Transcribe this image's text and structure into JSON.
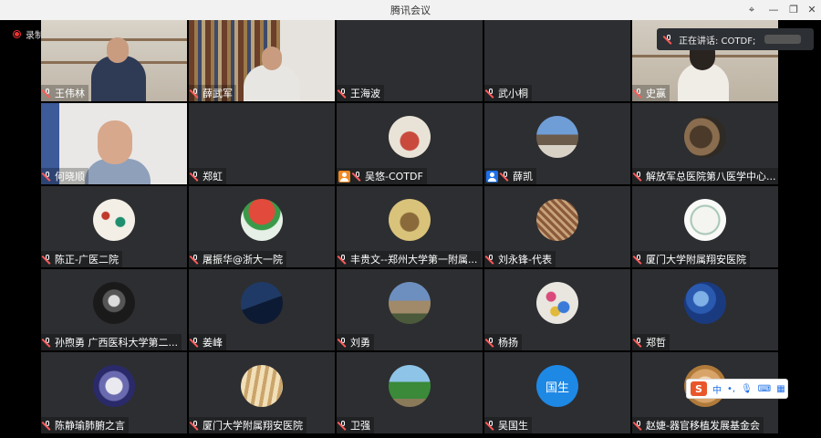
{
  "window": {
    "title": "腾讯会议"
  },
  "recording": {
    "label": "录制中"
  },
  "speaking": {
    "label": "正在讲话: COTDF;"
  },
  "ime": {
    "mode": "中"
  },
  "participants": [
    [
      "王伟林",
      "薛武军",
      "王海波",
      "武小桐",
      "史赢"
    ],
    [
      "何晓顺",
      "郑虹",
      "吴悠-COTDF",
      "薛凯",
      "解放军总医院第八医学中心..."
    ],
    [
      "陈正-广医二院",
      "屠振华@浙大一院",
      "丰贵文--郑州大学第一附属...",
      "刘永锋-代表",
      "厦门大学附属翔安医院"
    ],
    [
      "孙煦勇 广西医科大学第二...",
      "姜峰",
      "刘勇",
      "杨扬",
      "郑哲"
    ],
    [
      "陈静瑜肺腑之言",
      "厦门大学附属翔安医院",
      "卫强",
      "吴国生",
      "赵婕-器官移植发展基金会"
    ]
  ],
  "avatar_text": {
    "wu_guosheng": "国生"
  }
}
